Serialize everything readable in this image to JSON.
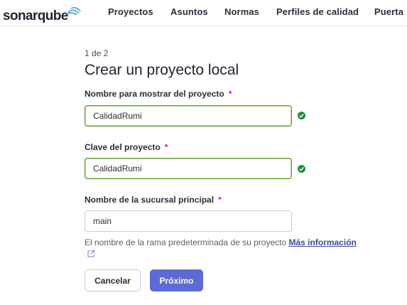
{
  "app": {
    "logo_text": "sonarqube"
  },
  "nav": {
    "items": [
      {
        "label": "Proyectos"
      },
      {
        "label": "Asuntos"
      },
      {
        "label": "Normas"
      },
      {
        "label": "Perfiles de calidad"
      },
      {
        "label": "Puerta"
      }
    ]
  },
  "form": {
    "step": "1 de 2",
    "title": "Crear un proyecto local",
    "required_mark": "*",
    "display_name": {
      "label": "Nombre para mostrar del proyecto",
      "value": "CalidadRumi",
      "valid": true
    },
    "project_key": {
      "label": "Clave del proyecto",
      "value": "CalidadRumi",
      "valid": true
    },
    "main_branch": {
      "label": "Nombre de la sucursal principal",
      "value": "main"
    },
    "help_text": "El nombre de la rama predeterminada de su proyecto",
    "help_link": "Más información",
    "cancel_label": "Cancelar",
    "next_label": "Próximo"
  },
  "colors": {
    "accent": "#5d6ad8",
    "valid_border": "#5b9a2a",
    "valid_icon": "#1f8f3a",
    "required": "#d02f3a"
  }
}
